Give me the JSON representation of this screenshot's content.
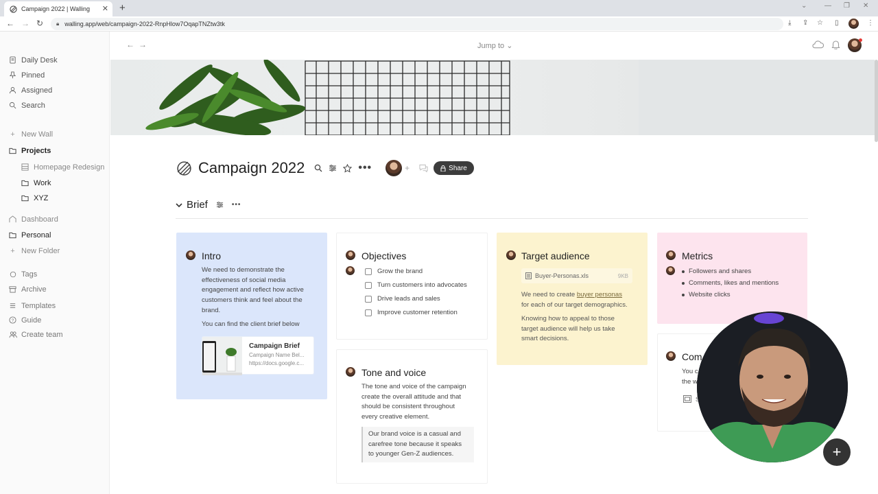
{
  "browser": {
    "tab_title": "Campaign 2022 | Walling",
    "url": "walling.app/web/campaign-2022-RnpHlow7OqapTNZtw3tk"
  },
  "sidebar": {
    "top": [
      {
        "label": "Daily Desk",
        "icon": "notebook-icon"
      },
      {
        "label": "Pinned",
        "icon": "pin-icon"
      },
      {
        "label": "Assigned",
        "icon": "user-icon"
      },
      {
        "label": "Search",
        "icon": "search-icon"
      }
    ],
    "new_wall": "New Wall",
    "projects": "Projects",
    "project_items": [
      {
        "label": "Homepage Redesign",
        "icon": "wall-icon"
      },
      {
        "label": "Work",
        "icon": "folder-icon"
      },
      {
        "label": "XYZ",
        "icon": "folder-icon"
      }
    ],
    "dashboard": "Dashboard",
    "personal": "Personal",
    "new_folder": "New Folder",
    "bottom": [
      {
        "label": "Tags",
        "icon": "tag-icon"
      },
      {
        "label": "Archive",
        "icon": "archive-icon"
      },
      {
        "label": "Templates",
        "icon": "templates-icon"
      },
      {
        "label": "Guide",
        "icon": "help-icon"
      },
      {
        "label": "Create team",
        "icon": "team-icon"
      }
    ]
  },
  "topbar": {
    "jump_to": "Jump to"
  },
  "page": {
    "title": "Campaign 2022",
    "share": "Share",
    "section": "Brief"
  },
  "cards": {
    "intro": {
      "title": "Intro",
      "color": "#dbe6fb",
      "lines": [
        "We need to demonstrate the",
        "effectiveness of social media",
        "engagement and reflect how active",
        "customers think and feel about the",
        "brand."
      ],
      "line2": "You can find the client brief below",
      "link_title": "Campaign Brief",
      "link_sub": "Campaign Name Bel...",
      "link_url": "https://docs.google.c..."
    },
    "objectives": {
      "title": "Objectives",
      "items": [
        "Grow the brand",
        "Turn customers into advocates",
        "Drive leads and sales",
        "Improve customer retention"
      ]
    },
    "tone": {
      "title": "Tone and voice",
      "lines": [
        "The tone and voice of the campaign",
        "create the overall attitude and that",
        "should be consistent throughout",
        "every creative element."
      ],
      "quote": [
        "Our brand voice is a casual and",
        "carefree tone because it speaks",
        "to younger Gen-Z audiences."
      ]
    },
    "audience": {
      "title": "Target audience",
      "color": "#fcf3cf",
      "file_name": "Buyer-Personas.xls",
      "file_size": "9KB",
      "text1_pre": "We need to create ",
      "text1_link": "buyer personas",
      "text1_post": "for each of our target demographics.",
      "lines2": [
        "Knowing how to appeal to those",
        "target audience will help us take",
        "smart decisions."
      ]
    },
    "metrics": {
      "title": "Metrics",
      "color": "#fde4ee",
      "items": [
        "Followers and shares",
        "Comments, likes and mentions",
        "Website clicks"
      ]
    },
    "comp": {
      "title": "Com",
      "line1": "You c",
      "line2": "the w",
      "file": "S"
    }
  }
}
